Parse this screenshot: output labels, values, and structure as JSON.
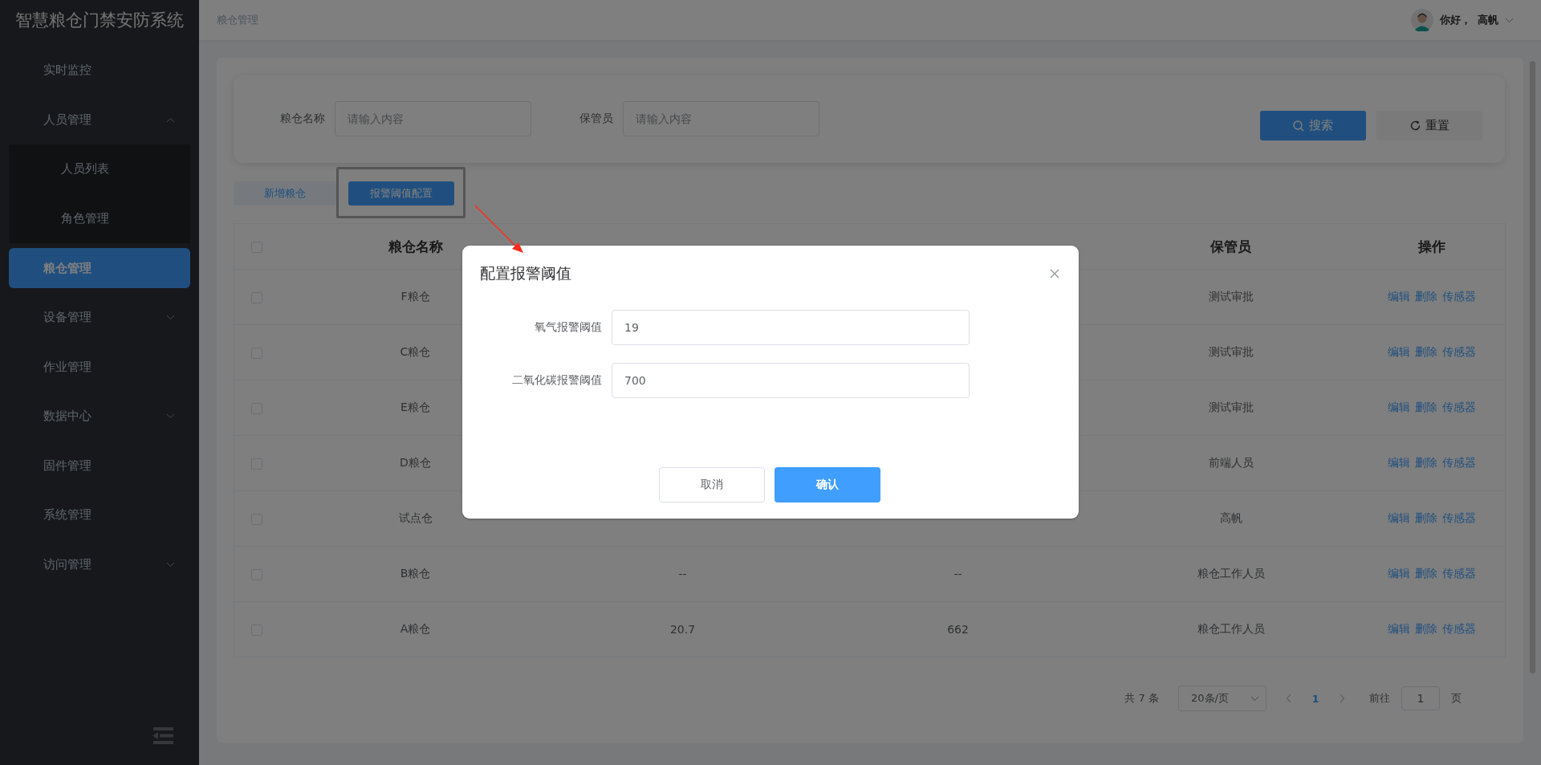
{
  "sidebar": {
    "title": "智慧粮仓门禁安防系统",
    "items": [
      {
        "label": "实时监控",
        "selected": false
      },
      {
        "label": "人员管理",
        "selected": false,
        "expanded": true,
        "children": [
          {
            "label": "人员列表",
            "selected": false
          },
          {
            "label": "角色管理",
            "selected": false
          }
        ]
      },
      {
        "label": "粮仓管理",
        "selected": true
      },
      {
        "label": "设备管理",
        "selected": false,
        "expanded": false
      },
      {
        "label": "作业管理",
        "selected": false
      },
      {
        "label": "数据中心",
        "selected": false,
        "expanded": false
      },
      {
        "label": "固件管理",
        "selected": false
      },
      {
        "label": "系统管理",
        "selected": false
      },
      {
        "label": "访问管理",
        "selected": false,
        "expanded": false
      }
    ]
  },
  "header": {
    "breadcrumb": "粮仓管理",
    "greeting": "你好，",
    "user": "高帆"
  },
  "search": {
    "fields": [
      {
        "label": "粮仓名称",
        "placeholder": "请输入内容"
      },
      {
        "label": "保管员",
        "placeholder": "请输入内容"
      }
    ],
    "search_button": "搜索",
    "reset_button": "重置"
  },
  "actions": [
    {
      "label": "新增粮仓",
      "kind": "plain",
      "highlighted": false
    },
    {
      "label": "报警阈值配置",
      "kind": "primary",
      "highlighted": true
    }
  ],
  "table": {
    "all_checked": false,
    "columns": [
      "粮仓名称",
      "保管员",
      "操作"
    ],
    "rows": [
      {
        "checked": false,
        "name": "F粮仓",
        "keeper": "测试审批",
        "actions": [
          "编辑",
          "删除",
          "传感器"
        ]
      },
      {
        "checked": false,
        "name": "C粮仓",
        "keeper": "测试审批",
        "actions": [
          "编辑",
          "删除",
          "传感器"
        ]
      },
      {
        "checked": false,
        "name": "E粮仓",
        "keeper": "测试审批",
        "actions": [
          "编辑",
          "删除",
          "传感器"
        ]
      },
      {
        "checked": false,
        "name": "D粮仓",
        "keeper": "前端人员",
        "actions": [
          "编辑",
          "删除",
          "传感器"
        ]
      },
      {
        "checked": false,
        "name": "试点仓",
        "keeper": "高帆",
        "actions": [
          "编辑",
          "删除",
          "传感器"
        ]
      },
      {
        "checked": false,
        "name": "B粮仓",
        "oxygen": "--",
        "co2": "--",
        "keeper": "粮仓工作人员",
        "actions": [
          "编辑",
          "删除",
          "传感器"
        ]
      },
      {
        "checked": false,
        "name": "A粮仓",
        "oxygen": "20.7",
        "co2": "662",
        "keeper": "粮仓工作人员",
        "actions": [
          "编辑",
          "删除",
          "传感器"
        ]
      }
    ]
  },
  "pagination": {
    "total": "共 7 条",
    "page_size": "20条/页",
    "pages": [
      {
        "label": "1",
        "selected": true
      }
    ],
    "goto": "前往",
    "page_input": "1",
    "page_unit": "页"
  },
  "dialog": {
    "title": "配置报警阈值",
    "fields": [
      {
        "label": "氧气报警阈值",
        "value": "19"
      },
      {
        "label": "二氧化碳报警阈值",
        "value": "700"
      }
    ],
    "cancel": "取消",
    "confirm": "确认"
  }
}
